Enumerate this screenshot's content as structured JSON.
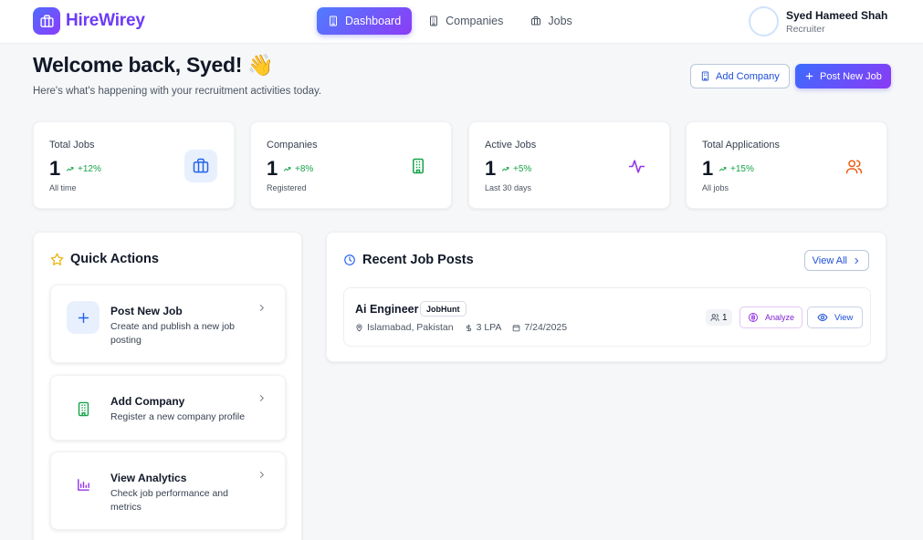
{
  "brand": {
    "name": "HireWirey",
    "logo_icon": "briefcase-icon",
    "gradient": [
      "#4f6bff",
      "#8b3dff"
    ]
  },
  "nav": {
    "items": [
      {
        "label": "Dashboard",
        "icon": "building-icon",
        "active": true
      },
      {
        "label": "Companies",
        "icon": "building-icon",
        "active": false
      },
      {
        "label": "Jobs",
        "icon": "briefcase-icon",
        "active": false
      }
    ]
  },
  "user": {
    "name": "Syed Hameed Shah",
    "role": "Recruiter"
  },
  "header": {
    "title": "Welcome back, Syed! 👋",
    "subtitle": "Here's what's happening with your recruitment activities today.",
    "add_company_label": "Add Company",
    "post_job_label": "Post New Job"
  },
  "stats": [
    {
      "label": "Total Jobs",
      "value": "1",
      "change": "+12%",
      "sub": "All time",
      "icon": "briefcase-icon",
      "icon_color": "#2563eb"
    },
    {
      "label": "Companies",
      "value": "1",
      "change": "+8%",
      "sub": "Registered",
      "icon": "building-icon",
      "icon_color": "#16a34a"
    },
    {
      "label": "Active Jobs",
      "value": "1",
      "change": "+5%",
      "sub": "Last 30 days",
      "icon": "activity-icon",
      "icon_color": "#9333ea"
    },
    {
      "label": "Total Applications",
      "value": "1",
      "change": "+15%",
      "sub": "All jobs",
      "icon": "users-icon",
      "icon_color": "#ea580c"
    }
  ],
  "quick_actions": {
    "title": "Quick Actions",
    "items": [
      {
        "title": "Post New Job",
        "desc": "Create and publish a new job posting",
        "icon": "plus-icon"
      },
      {
        "title": "Add Company",
        "desc": "Register a new company profile",
        "icon": "building-icon"
      },
      {
        "title": "View Analytics",
        "desc": "Check job performance and metrics",
        "icon": "bar-chart-icon"
      }
    ]
  },
  "recent_jobs": {
    "title": "Recent Job Posts",
    "view_all_label": "View All",
    "jobs": [
      {
        "title": "Ai Engineer",
        "tag": "JobHunt",
        "location": "Islamabad, Pakistan",
        "salary": "3 LPA",
        "date": "7/24/2025",
        "applicants": "1",
        "analyze_label": "Analyze",
        "view_label": "View"
      }
    ]
  }
}
